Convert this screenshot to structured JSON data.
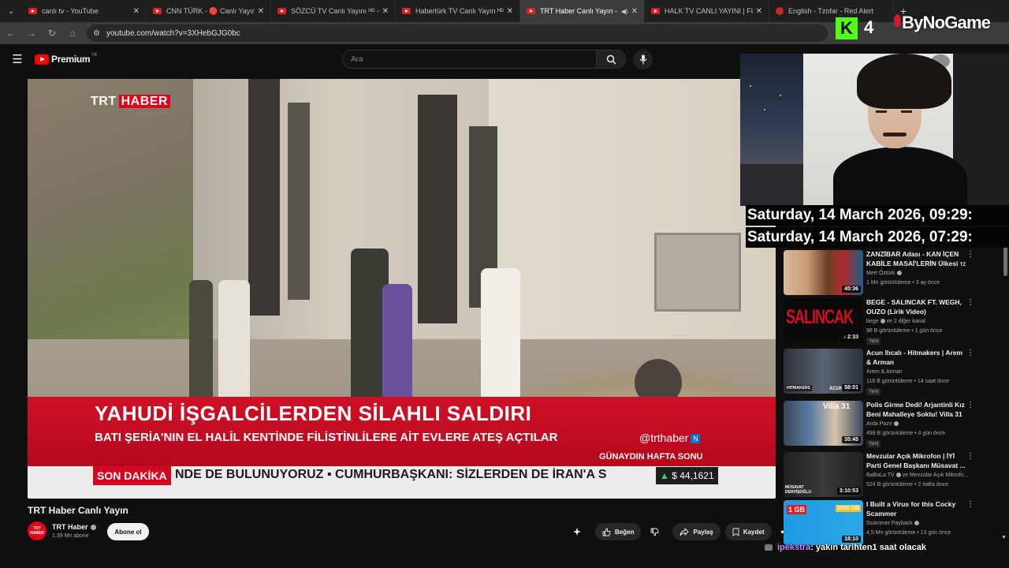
{
  "browser": {
    "tabs": [
      {
        "label": "canlı tv - YouTube",
        "active": false
      },
      {
        "label": "CNN TÜRK - 🔴 Canlı Yayın ᴴᴰ",
        "active": false
      },
      {
        "label": "SÖZCÜ TV Canlı Yayını ᴴᴰ - You",
        "active": false
      },
      {
        "label": "Habertürk TV Canlı Yayın ᴴᴰ - Yo",
        "active": false
      },
      {
        "label": "TRT Haber Canlı Yayın - You",
        "active": true
      },
      {
        "label": "HALK TV CANLI YAYINI | FULL I",
        "active": false
      },
      {
        "label": "English - Tzofar - Red Alert",
        "active": false
      }
    ],
    "url": "youtube.com/watch?v=3XHebGJG0bc"
  },
  "youtube": {
    "brand": "Premium",
    "country": "TR",
    "search_placeholder": "Ara"
  },
  "player": {
    "channel_logo_left": "TRT",
    "channel_logo_right": "HABER",
    "headline": "YAHUDİ İŞGALCİLERDEN SİLAHLI SALDIRI",
    "subheadline": "BATI ŞERİA'NIN EL HALİL KENTİNDE FİLİSTİNLİLERE AİT EVLERE ATEŞ AÇTILAR",
    "handle": "@trthaber",
    "handle_badge": "N",
    "program": "GÜNAYDIN HAFTA SONU",
    "ticker_label": "SON DAKİKA",
    "ticker_text": "NDE DE BULUNUYORUZ  ▪  CUMHURBAŞKANI: SİZLERDEN DE İRAN'A S",
    "fx_arrow": "▲",
    "fx_value": "$ 44,1621"
  },
  "video": {
    "title": "TRT Haber Canlı Yayın",
    "channel": "TRT Haber",
    "subscribers": "1,39 Mn abone",
    "avatar_text": "TRT HABER",
    "subscribe": "Abone ol",
    "like": "Beğen",
    "share": "Paylaş",
    "save": "Kaydet"
  },
  "overlay": {
    "kick_letter": "K",
    "kick_count": "4",
    "sponsor": "ByNoGame",
    "clock_1": "Saturday, 14 March 2026, 09:29:",
    "clock_2": "Saturday, 14 March 2026, 07:29:",
    "chat_user": "ipekstra",
    "chat_message": ": yakın tarihten1 saat olacak"
  },
  "sidebar": {
    "items": [
      {
        "title": "ZANZİBAR Adası - KAN İÇEN KABİLE MASAİ'LERİN Ülkesi",
        "title_tag": "TZ",
        "channel": "Mert Öztürk",
        "verified": true,
        "meta": "1 Mn görüntüleme • 3 ay önce",
        "duration": "45:36",
        "badge": "",
        "thumb_colors": [
          "#c89a74",
          "#6b3f2a",
          "#1a5d8a"
        ]
      },
      {
        "title": "BEGE - SALINCAK FT. WEGH, OUZO (Lirik Video)",
        "title_tag": "",
        "channel": "bege",
        "channel_suffix": "ve 2 diğer kanal",
        "verified": true,
        "meta": "96 B görüntüleme • 1 gün önce",
        "duration": "♪ 2:33",
        "badge": "Yeni",
        "thumb_text": "SALINCAK",
        "thumb_colors": [
          "#0a0a0a",
          "#d4101d",
          "#ffffff"
        ]
      },
      {
        "title": "Acun Ilıcalı - Hitmakers | Arem & Arman",
        "title_tag": "",
        "channel": "Arem & Arman",
        "verified": false,
        "meta": "116 B görüntüleme • 14 saat önce",
        "duration": "58:01",
        "badge": "Yeni",
        "thumb_text": "HITMAKERS",
        "thumb_sub": "ACUN ILI",
        "thumb_colors": [
          "#2b2f38",
          "#5b6474",
          "#111111"
        ]
      },
      {
        "title": "Polis Girme Dedi! Arjantinli Kız Beni Mahalleye Soktu! Villa 31",
        "title_tag": "",
        "channel": "Arda Pazır",
        "verified": true,
        "meta": "499 B görüntüleme • 4 gün önce",
        "duration": "35:45",
        "badge": "Yeni",
        "thumb_text": "Villa 31",
        "thumb_colors": [
          "#5f7fa3",
          "#d7c2a8",
          "#39455a"
        ]
      },
      {
        "title": "Mevzular Açık Mikrofon | İYİ Parti Genel Başkanı Müsavat ...",
        "title_tag": "",
        "channel": "BaBaLa TV",
        "verified": true,
        "channel_suffix": "ve Mevzular Açık Mikrofo...",
        "meta": "524 B görüntüleme • 2 hafta önce",
        "duration": "3:10:53",
        "badge": "",
        "thumb_text": "MÜSAVAT DERVİŞOĞLU",
        "thumb_colors": [
          "#202020",
          "#3a3a3a",
          "#8c8c8c"
        ]
      },
      {
        "title": "I Built a Virus for this Cocky Scammer",
        "title_tag": "",
        "channel": "Scammer Payback",
        "verified": true,
        "meta": "4,5 Mn görüntüleme • 13 gün önce",
        "duration": "18:10",
        "badge": "",
        "thumb_text_left": "1 GB",
        "thumb_text_right": "1000 GB",
        "thumb_colors": [
          "#1e9be0",
          "#e02020",
          "#f2c230"
        ]
      }
    ]
  },
  "colors": {
    "youtube_red": "#ff0000",
    "trt_red": "#d3071f",
    "kick_green": "#53fc18",
    "chat_user": "#c58cff",
    "page_bg": "#0f0f0f"
  }
}
